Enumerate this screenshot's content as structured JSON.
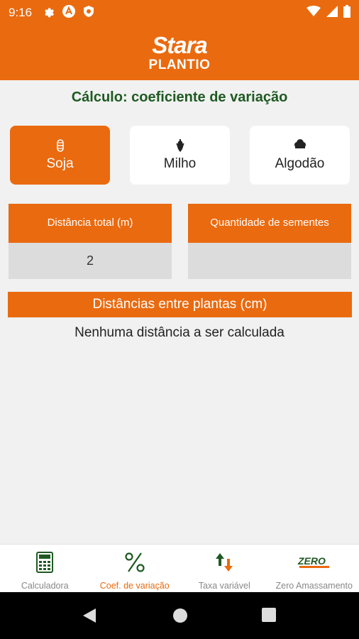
{
  "status_bar": {
    "time": "9:16",
    "left_icons": [
      "gear-icon",
      "app-logo-icon",
      "shield-icon"
    ],
    "right_icons": [
      "wifi-icon",
      "signal-icon",
      "battery-icon"
    ]
  },
  "header": {
    "brand": "Stara",
    "subtitle": "PLANTIO"
  },
  "calc_title": "Cálculo: coeficiente de variação",
  "crops": [
    {
      "label": "Soja",
      "icon": "soy-icon",
      "active": true
    },
    {
      "label": "Milho",
      "icon": "corn-icon",
      "active": false
    },
    {
      "label": "Algodão",
      "icon": "cotton-icon",
      "active": false
    }
  ],
  "fields": {
    "total_distance": {
      "label": "Distância total (m)",
      "value": "2"
    },
    "seed_quantity": {
      "label": "Quantidade de sementes",
      "value": ""
    }
  },
  "distances": {
    "header": "Distâncias entre plantas (cm)",
    "empty_message": "Nenhuma distância a ser calculada"
  },
  "bottom_nav": [
    {
      "label": "Calculadora",
      "icon": "calculator-icon",
      "active": false
    },
    {
      "label": "Coef. de variação",
      "icon": "percent-icon",
      "active": true
    },
    {
      "label": "Taxa variável",
      "icon": "up-down-arrows-icon",
      "active": false
    },
    {
      "label": "Zero Amassamento",
      "icon": "zero-logo-icon",
      "active": false
    }
  ],
  "colors": {
    "primary": "#ea6a0f",
    "title_green": "#1f5a22",
    "field_bg": "#dcdcdc",
    "background": "#f1f1f1"
  }
}
